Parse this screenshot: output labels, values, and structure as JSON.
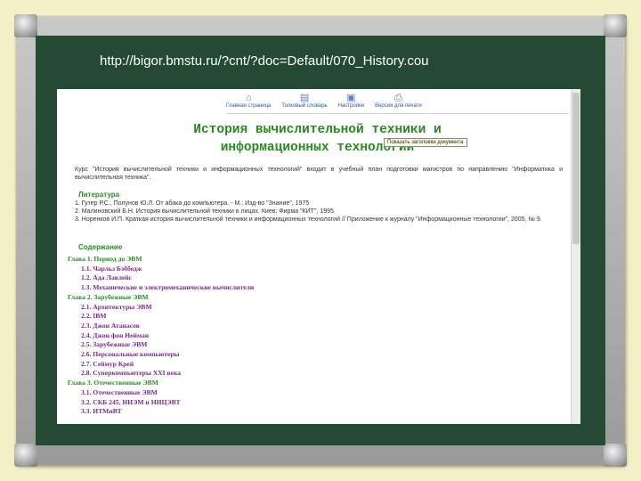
{
  "slide": {
    "url_caption": "http://bigor.bmstu.ru/?cnt/?doc=Default/070_History.cou"
  },
  "toolbar": {
    "items": [
      {
        "label": "Главная страница",
        "icon": "home-icon"
      },
      {
        "label": "Толковый словарь",
        "icon": "book-icon"
      },
      {
        "label": "Настройки",
        "icon": "settings-icon"
      },
      {
        "label": "Версия для печати",
        "icon": "print-icon"
      }
    ]
  },
  "page": {
    "title_line1": "История вычислительной техники и",
    "title_line2": "информационных технологий",
    "tooltip": "Показать заголовки документа",
    "intro": "Курс \"История вычислительной техники и информационных технологий\" входит в учебный план подготовки магистров по направлению \"Информатика и вычислительная техника\".",
    "literature_heading": "Литература",
    "literature": [
      "1. Гутер Р.С., Полунов Ю.Л. От абака до компьютера. - М.: Изд-во \"Знание\", 1975",
      "2. Малиновский Б.Н. История вычислительной техники в лицах. Киев: Фирма \"КИТ\", 1995.",
      "3. Норенков И.П. Краткая история вычислительной техники и информационных технологий // Приложение к журналу \"Информационные технологии\", 2005, № 9."
    ],
    "contents_heading": "Содержание",
    "toc": [
      {
        "label": "Глава 1. Период до ЭВМ",
        "level": 0
      },
      {
        "label": "1.1. Чарльз Бэббедж",
        "level": 1
      },
      {
        "label": "1.2. Ада Лавлейс",
        "level": 1
      },
      {
        "label": "1.3. Механические и электромеханические вычислители",
        "level": 1
      },
      {
        "label": "Глава 2. Зарубежные ЭВМ",
        "level": 0
      },
      {
        "label": "2.1. Архитектуры ЭВМ",
        "level": 1
      },
      {
        "label": "2.2. IBM",
        "level": 1
      },
      {
        "label": "2.3. Джон Атанасов",
        "level": 1
      },
      {
        "label": "2.4. Джон фон Нейман",
        "level": 1
      },
      {
        "label": "2.5. Зарубежные ЭВМ",
        "level": 1
      },
      {
        "label": "2.6. Персональные компьютеры",
        "level": 1
      },
      {
        "label": "2.7. Сеймур Крей",
        "level": 1
      },
      {
        "label": "2.8. Суперкомпьютеры XXI века",
        "level": 1
      },
      {
        "label": "Глава 3. Отечественные ЭВМ",
        "level": 0
      },
      {
        "label": "3.1. Отечественные ЭВМ",
        "level": 1
      },
      {
        "label": "3.2. СКБ 245, НИЭМ и НИЦЭВТ",
        "level": 1
      },
      {
        "label": "3.3. ИТМиВТ",
        "level": 1
      }
    ]
  }
}
